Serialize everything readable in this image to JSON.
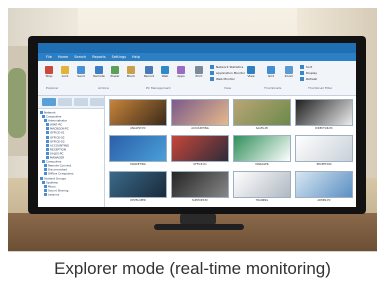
{
  "caption": "Explorer mode (real-time monitoring)",
  "app": {
    "menu_tabs": [
      "File",
      "Home",
      "Search",
      "Reports",
      "Settings",
      "Help"
    ],
    "ribbon": {
      "buttons": [
        {
          "label": "Stop",
          "icon": "stop-icon",
          "color": "#c84a3a"
        },
        {
          "label": "Lock",
          "icon": "lock-icon",
          "color": "#e0b33a"
        },
        {
          "label": "Send",
          "icon": "message-icon",
          "color": "#4b92d4"
        },
        {
          "label": "Remote",
          "icon": "remote-icon",
          "color": "#3b7fc2"
        },
        {
          "label": "Power",
          "icon": "power-icon",
          "color": "#5aa05a"
        },
        {
          "label": "Block",
          "icon": "block-icon",
          "color": "#c9a04a"
        },
        {
          "label": "Record",
          "icon": "record-icon",
          "color": "#4a7ab6"
        },
        {
          "label": "Web",
          "icon": "web-icon",
          "color": "#2f89c9"
        },
        {
          "label": "Apps",
          "icon": "apps-icon",
          "color": "#9a6bc2"
        },
        {
          "label": "Print",
          "icon": "print-icon",
          "color": "#7a8a9a"
        },
        {
          "label": "View",
          "icon": "view-icon",
          "color": "#2f7fc2"
        },
        {
          "label": "Grid",
          "icon": "grid-icon",
          "color": "#3f8fd2"
        },
        {
          "label": "Zoom",
          "icon": "zoom-icon",
          "color": "#5a9ad0"
        }
      ],
      "small_items": [
        "Network Statistics",
        "Application Monitor",
        "Web Monitor",
        "Sort",
        "Display",
        "Refresh"
      ],
      "groups": [
        "Explorer",
        "Actions",
        "PC Management",
        "View",
        "Thumbnails",
        "Thumbnail Filter"
      ]
    },
    "tree": {
      "items": [
        "Network",
        "Computers",
        "Administrator",
        "WIN7-PC",
        "MACBOOK-PC",
        "OFFICE-01",
        "OFFICE-02",
        "OFFICE-03",
        "ACCOUNTING",
        "RECEPTION",
        "SALES-PC",
        "MANAGER",
        "Computers",
        "Remote Connect",
        "Disconnected",
        "Offline Computers",
        "Student Groups",
        "Systems",
        "Music",
        "Sound Sharing",
        "Lessons"
      ]
    },
    "thumbnails": [
      {
        "label": "ANALYST-PC",
        "color": "#c8843a",
        "bg2": "#3b2a1a"
      },
      {
        "label": "ACCOUNTING",
        "color": "#7a5a8a",
        "bg2": "#e6b98a"
      },
      {
        "label": "SALES-PC",
        "color": "#b9a576",
        "bg2": "#6c8a4a"
      },
      {
        "label": "DIRECTOR-PC",
        "color": "#1f1f1f",
        "bg2": "#ececec"
      },
      {
        "label": "MARKETING",
        "color": "#2b5fa9",
        "bg2": "#4aa0d8"
      },
      {
        "label": "OFFICE-01",
        "color": "#c7463a",
        "bg2": "#2c2c3a"
      },
      {
        "label": "MANAGER",
        "color": "#2f8f5a",
        "bg2": "#ffffff"
      },
      {
        "label": "RECEPTION",
        "color": "#ffffff",
        "bg2": "#c8d0d8"
      },
      {
        "label": "DEVELOPER",
        "color": "#3a6a8a",
        "bg2": "#1a2a3a"
      },
      {
        "label": "SUPPORT-PC",
        "color": "#242424",
        "bg2": "#888888"
      },
      {
        "label": "TRAINING",
        "color": "#ffffff",
        "bg2": "#b0b8c2"
      },
      {
        "label": "ADMIN-PC",
        "color": "#d7e6f3",
        "bg2": "#5b8fc2"
      }
    ]
  }
}
